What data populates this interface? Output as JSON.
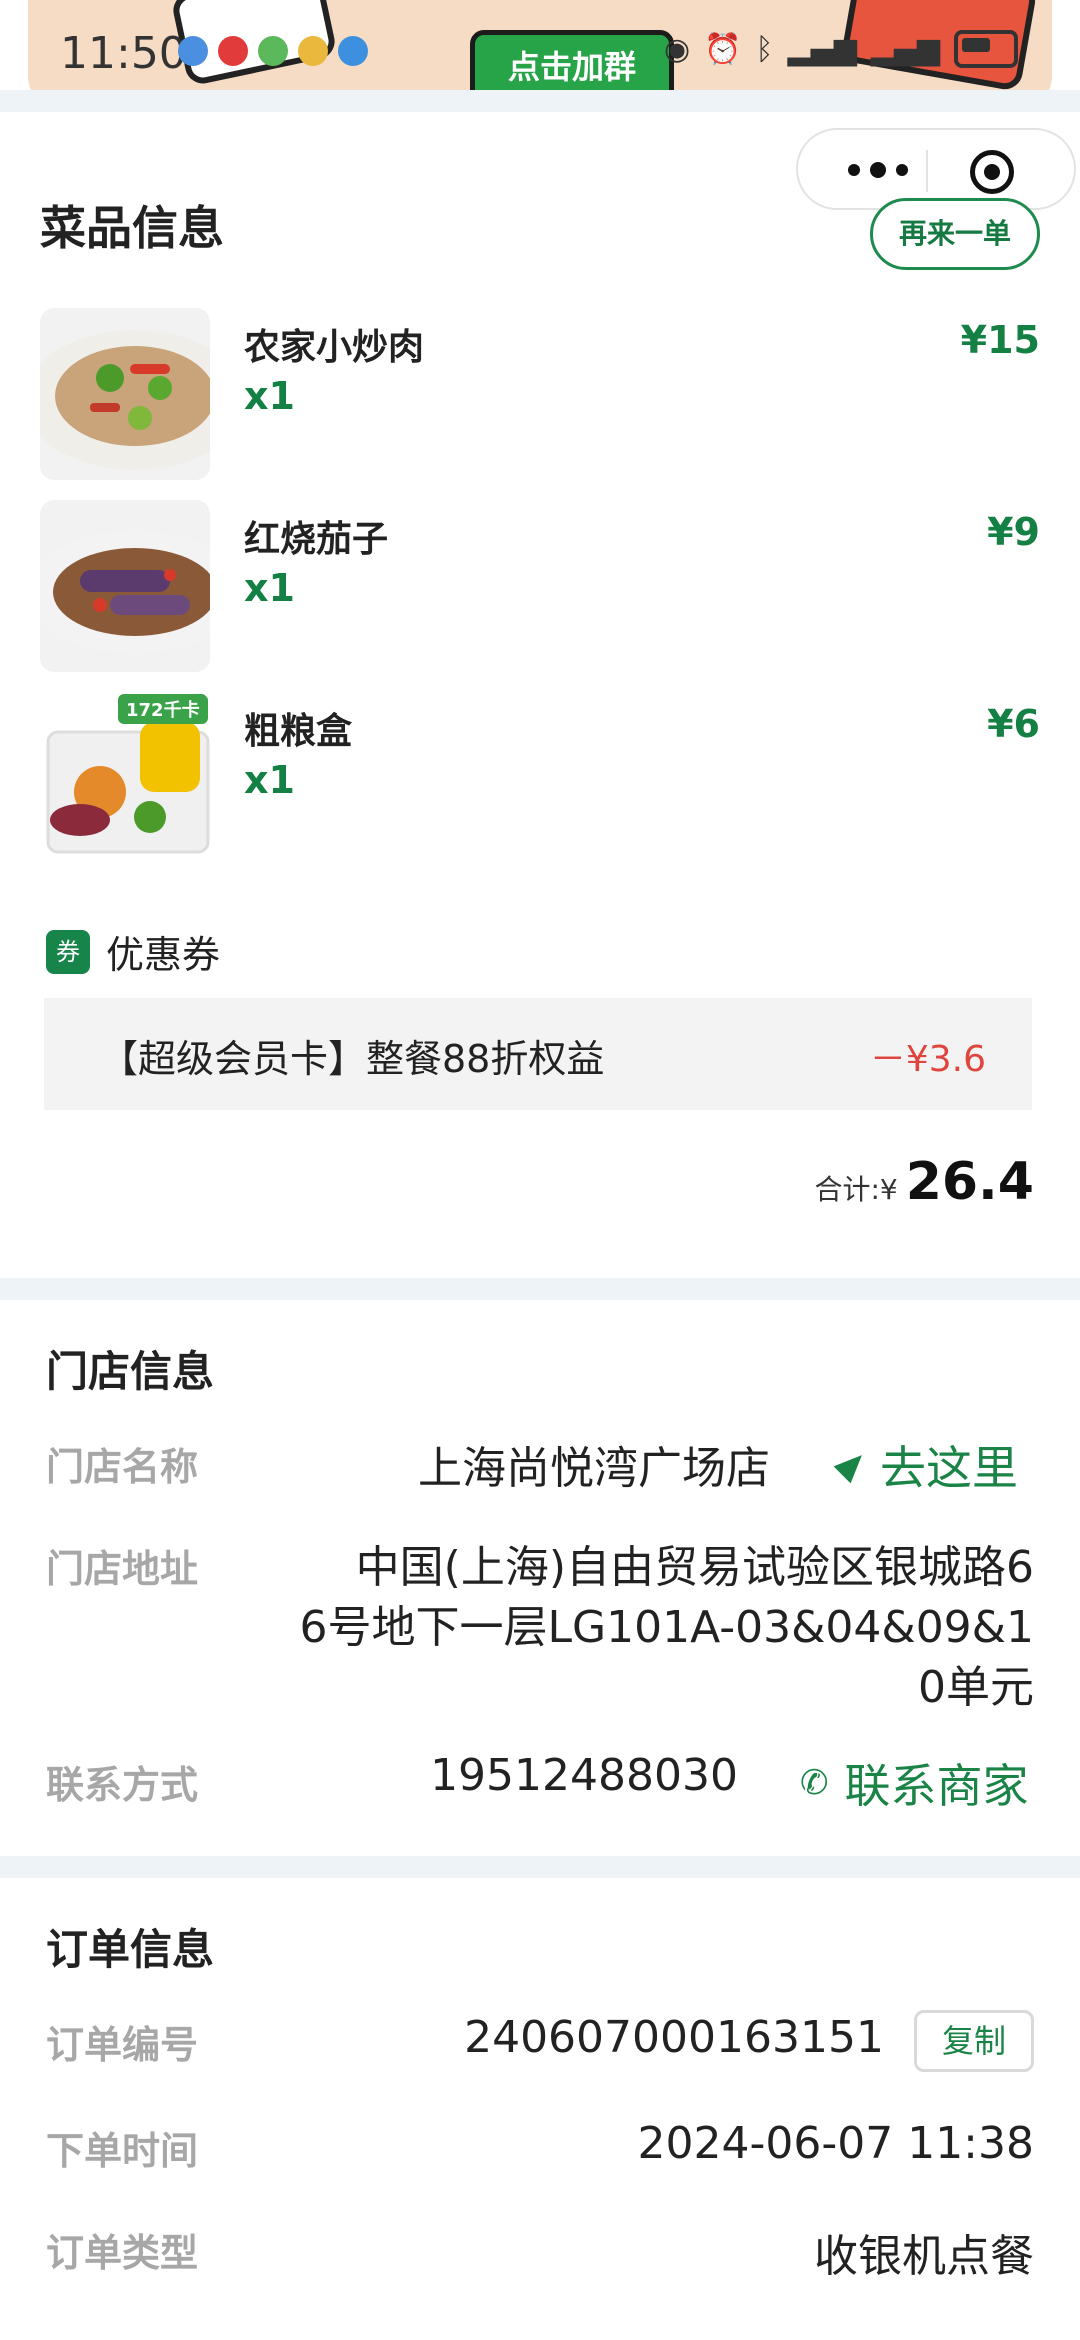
{
  "status_bar": {
    "time": "11:50"
  },
  "banner": {
    "join_label": "点击加群"
  },
  "dishes_section": {
    "title": "菜品信息",
    "reorder_label": "再来一单",
    "items": [
      {
        "name": "农家小炒肉",
        "qty": "x1",
        "price": "¥15"
      },
      {
        "name": "红烧茄子",
        "qty": "x1",
        "price": "¥9"
      },
      {
        "name": "粗粮盒",
        "qty": "x1",
        "price": "¥6",
        "tag": "172千卡"
      }
    ],
    "coupon": {
      "badge": "券",
      "label": "优惠券",
      "desc": "【超级会员卡】整餐88折权益",
      "amount": "－¥3.6"
    },
    "total": {
      "label": "合计:¥",
      "value": "26.4"
    }
  },
  "store_section": {
    "title": "门店信息",
    "name_label": "门店名称",
    "name_value": "上海尚悦湾广场店",
    "go_label": "去这里",
    "address_label": "门店地址",
    "address_lines": [
      "中国(上海)自由贸易试验区银城路6",
      "6号地下一层LG101A-03&04&09&1",
      "0单元"
    ],
    "contact_label": "联系方式",
    "contact_value": "19512488030",
    "contact_merchant": "联系商家"
  },
  "order_section": {
    "title": "订单信息",
    "no_label": "订单编号",
    "no_value": "240607000163151",
    "copy_label": "复制",
    "time_label": "下单时间",
    "time_value": "2024-06-07 11:38",
    "type_label": "订单类型",
    "type_value": "收银机点餐"
  },
  "colors": {
    "accent_green": "#158043",
    "discount_red": "#e0453d",
    "section_gap": "#eef3f7"
  }
}
